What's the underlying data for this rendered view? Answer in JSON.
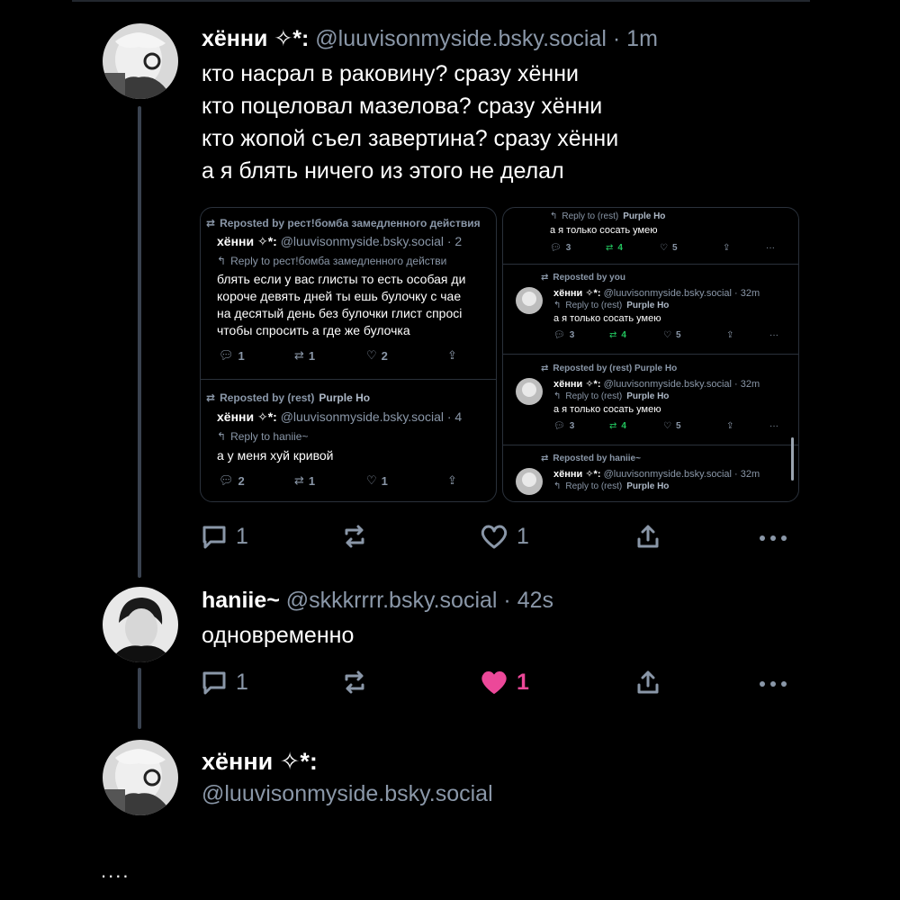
{
  "post1": {
    "name": "хённи ✧*:",
    "handle": "@luuvisonmyside.bsky.social",
    "time": "1m",
    "lines": [
      "кто насрал в раковину? сразу хённи",
      "кто поцеловал мазелова? сразу хённи",
      "кто жопой съел завертина? сразу хённи",
      "а я блять ничего из этого не делал"
    ],
    "reply_count": "1",
    "like_count": "1"
  },
  "embed_left": {
    "item1": {
      "repost": "Reposted by рест!бомба замедленного действия",
      "name": "хённи ✧*:",
      "handle": "@luuvisonmyside.bsky.social · 2",
      "reply_to": "Reply to рест!бомба замедленного действи",
      "lines": [
        "блять если у вас глисты то есть особая ди",
        "короче девять дней ты ешь булочку с чае",
        "на десятый день без булочки глист спросі",
        "чтобы спросить а где же булочка"
      ],
      "replies": "1",
      "reposts": "1",
      "likes": "2"
    },
    "item2": {
      "repost_prefix": "Reposted by (rest)",
      "repost_user": "Purple Ho",
      "name": "хённи ✧*:",
      "handle": "@luuvisonmyside.bsky.social · 4",
      "reply_to": "Reply to haniie~",
      "text": "а у меня хуй кривой",
      "replies": "2",
      "reposts": "1",
      "likes": "1"
    }
  },
  "embed_right": {
    "reply_prefix": "Reply to (rest)",
    "reply_user": "Purple Ho",
    "text": "а я только сосать умею",
    "name": "хённи ✧*:",
    "handle": "@luuvisonmyside.bsky.social · 32m",
    "replies": "3",
    "reposts": "4",
    "likes": "5",
    "repost_you": "Reposted by you",
    "repost_rest": "Reposted by (rest) Purple Ho",
    "repost_haniie": "Reposted by haniie~",
    "cut_text": "а я только сосать умею"
  },
  "post2": {
    "name": "haniie~",
    "handle": "@skkkrrrr.bsky.social",
    "time": "42s",
    "text": "одновременно",
    "reply_count": "1",
    "like_count": "1"
  },
  "post3": {
    "name": "хённи ✧*:",
    "handle": "@luuvisonmyside.bsky.social"
  },
  "footer": {
    "ellipsis": "...."
  },
  "colors": {
    "background": "#000000",
    "muted": "#8a97a8",
    "like": "#ec4899",
    "repost_green": "#22c55e"
  }
}
